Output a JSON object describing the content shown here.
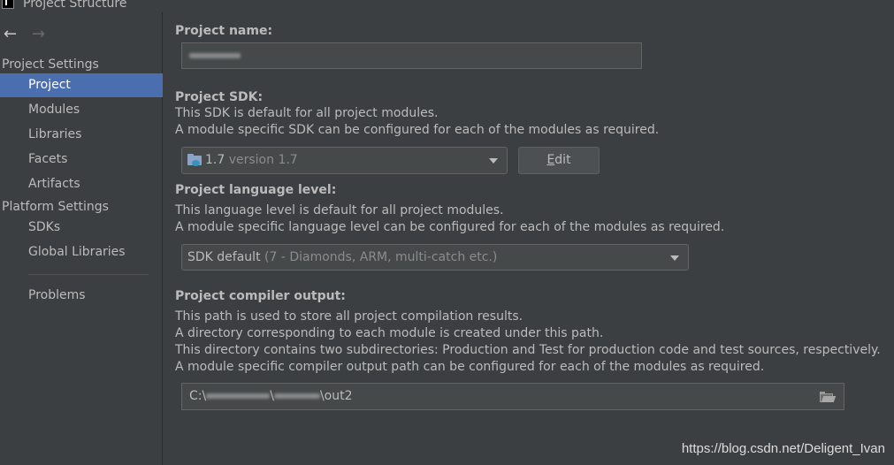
{
  "window": {
    "title": "Project Structure"
  },
  "sidebar": {
    "project_settings_header": "Project Settings",
    "project_settings_items": [
      {
        "label": "Project",
        "selected": true
      },
      {
        "label": "Modules"
      },
      {
        "label": "Libraries"
      },
      {
        "label": "Facets"
      },
      {
        "label": "Artifacts"
      }
    ],
    "platform_settings_header": "Platform Settings",
    "platform_settings_items": [
      {
        "label": "SDKs"
      },
      {
        "label": "Global Libraries"
      }
    ],
    "problems_label": "Problems"
  },
  "main": {
    "project_name": {
      "label": "Project name:",
      "value": ""
    },
    "project_sdk": {
      "label": "Project SDK:",
      "desc_line1": "This SDK is default for all project modules.",
      "desc_line2": "A module specific SDK can be configured for each of the modules as required.",
      "selected_name": "1.7",
      "selected_version": "version 1.7",
      "edit_mnemonic": "E",
      "edit_rest": "dit"
    },
    "language_level": {
      "label": "Project language level:",
      "desc_line1": "This language level is default for all project modules.",
      "desc_line2": "A module specific language level can be configured for each of the modules as required.",
      "selected_value": "SDK default",
      "selected_detail": "(7 - Diamonds, ARM, multi-catch etc.)"
    },
    "compiler_output": {
      "label": "Project compiler output:",
      "desc_line1": "This path is used to store all project compilation results.",
      "desc_line2": "A directory corresponding to each module is created under this path.",
      "desc_line3": "This directory contains two subdirectories: Production and Test for production code and test sources, respectively.",
      "desc_line4": "A module specific compiler output path can be configured for each of the modules as required.",
      "path_prefix": "C:\\",
      "path_sep1": "\\",
      "path_sep2": "\\",
      "path_suffix": "out2"
    }
  },
  "watermark": "https://blog.csdn.net/Deligent_Ivan",
  "icons": {
    "back": "back-arrow-icon",
    "forward": "forward-arrow-icon",
    "sdk": "sdk-folder-icon",
    "browse": "folder-open-icon"
  },
  "colors": {
    "background": "#3c3f41",
    "selection": "#4b6eaf",
    "field_bg": "#45494a",
    "text": "#bbbbbb"
  }
}
